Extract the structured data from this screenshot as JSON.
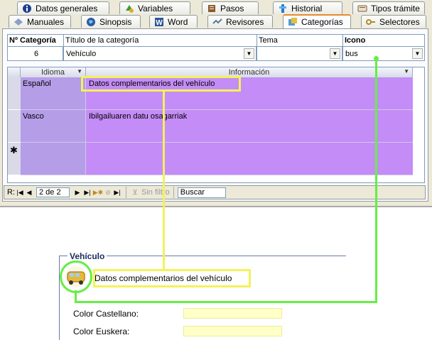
{
  "tabs_row1": [
    {
      "label": "Datos generales",
      "icon": "info-icon"
    },
    {
      "label": "Variables",
      "icon": "variables-icon"
    },
    {
      "label": "Pasos",
      "icon": "book-icon"
    },
    {
      "label": "Historial",
      "icon": "history-icon"
    },
    {
      "label": "Tipos trámite",
      "icon": "tag-icon"
    }
  ],
  "tabs_row2": [
    {
      "label": "Manuales",
      "icon": "manual-icon"
    },
    {
      "label": "Sinopsis",
      "icon": "globe-icon"
    },
    {
      "label": "Word",
      "icon": "word-icon"
    },
    {
      "label": "Revisores",
      "icon": "review-icon"
    },
    {
      "label": "Categorías",
      "icon": "categories-icon"
    },
    {
      "label": "Selectores",
      "icon": "key-icon"
    }
  ],
  "header": {
    "num_label": "Nº Categoría",
    "title_label": "Título de la categoría",
    "tema_label": "Tema",
    "icono_label": "Icono",
    "num_value": "6",
    "title_value": "Vehículo",
    "tema_value": "",
    "icono_value": "bus"
  },
  "subgrid": {
    "col_idioma": "Idioma",
    "col_info": "Información",
    "rows": [
      {
        "idioma": "Español",
        "info": "Datos complementarios del vehículo"
      },
      {
        "idioma": "Vasco",
        "info": "Ibilgailuaren datu osagarriak"
      }
    ],
    "new_row_marker": "✱"
  },
  "nav": {
    "record_label": "R:",
    "position": "2 de 2",
    "filter_label": "Sin filtro",
    "search_placeholder": "Buscar"
  },
  "form": {
    "legend": "Vehículo",
    "description": "Datos complementarios del vehículo",
    "color_castellano_label": "Color Castellano:",
    "color_euskera_label": "Color Euskera:"
  },
  "colors": {
    "row_highlight": "#c48cf6",
    "callout_yellow": "#f2f25a",
    "callout_green": "#66ee44",
    "active_tab_accent": "#e68b2c"
  }
}
